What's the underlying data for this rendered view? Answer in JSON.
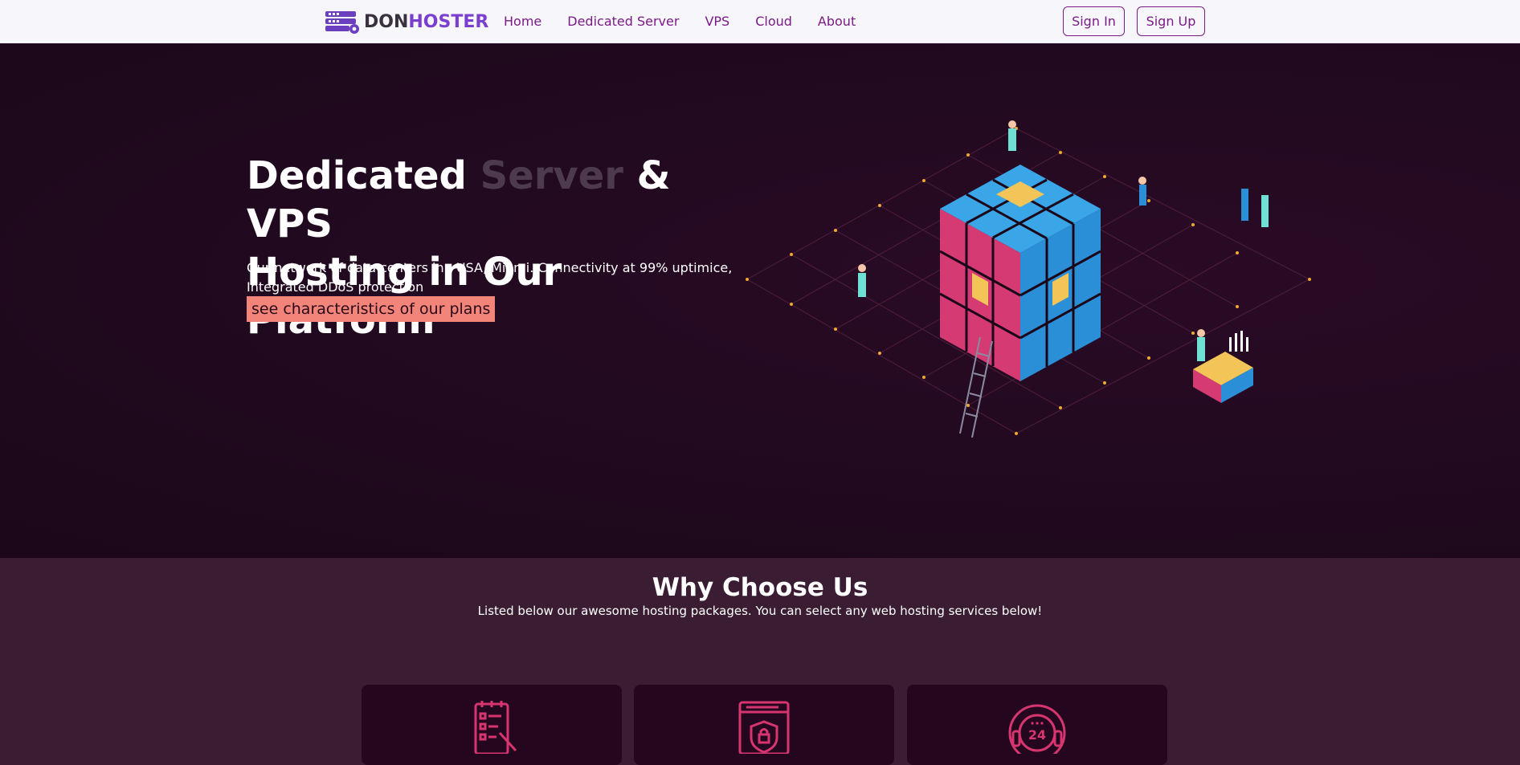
{
  "brand": {
    "part1": "DON",
    "part2": "HOSTER"
  },
  "nav": {
    "items": [
      {
        "label": "Home"
      },
      {
        "label": "Dedicated Server"
      },
      {
        "label": "VPS"
      },
      {
        "label": "Cloud"
      },
      {
        "label": "About"
      }
    ],
    "sign_in": "Sign In",
    "sign_up": "Sign Up"
  },
  "hero": {
    "title_part1": "Dedicated ",
    "title_dim": "Server",
    "title_part2": " & VPS",
    "title_line2": "Hosting in Our Platform",
    "description": "Our network of data centers in , USA, Miami. Connectivity at 99% uptimice, Integrated DDoS protection",
    "cta": "see characteristics of our plans"
  },
  "why": {
    "title": "Why Choose Us",
    "subtitle": "Listed below our awesome hosting packages. You can select any web hosting services below!"
  },
  "cards": [
    {
      "icon": "checklist-icon"
    },
    {
      "icon": "secure-browser-icon"
    },
    {
      "icon": "support-24-icon"
    }
  ],
  "colors": {
    "brand_purple": "#7a1a86",
    "cta_salmon": "#f2847a",
    "hero_bg": "#1f081c",
    "section_bg": "#3a1d33",
    "card_bg": "#24061f",
    "icon_pink": "#d6356f"
  }
}
